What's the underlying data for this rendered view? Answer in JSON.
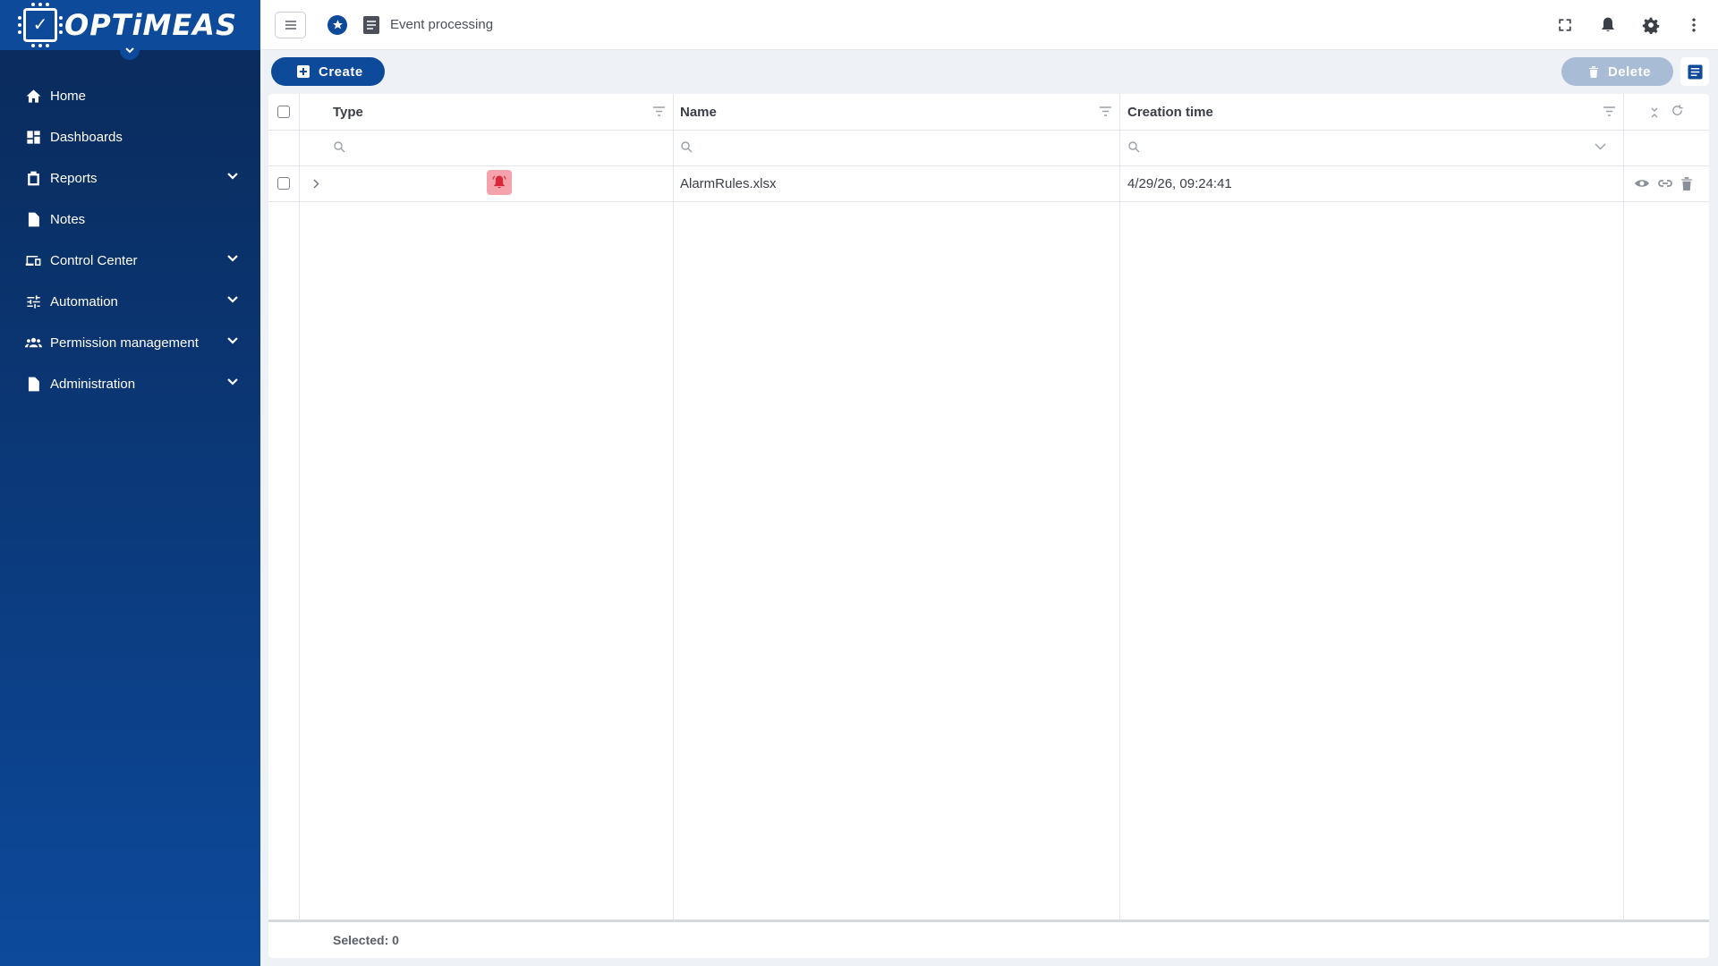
{
  "app": {
    "logo_text": "OPTiMEAS"
  },
  "sidebar": {
    "items": [
      {
        "label": "Home",
        "icon": "home-icon",
        "expandable": false
      },
      {
        "label": "Dashboards",
        "icon": "dashboard-icon",
        "expandable": false
      },
      {
        "label": "Reports",
        "icon": "clipboard-icon",
        "expandable": true
      },
      {
        "label": "Notes",
        "icon": "document-icon",
        "expandable": false
      },
      {
        "label": "Control Center",
        "icon": "devices-icon",
        "expandable": true
      },
      {
        "label": "Automation",
        "icon": "sliders-icon",
        "expandable": true
      },
      {
        "label": "Permission management",
        "icon": "group-icon",
        "expandable": true
      },
      {
        "label": "Administration",
        "icon": "admin-doc-icon",
        "expandable": true
      }
    ]
  },
  "header": {
    "page_title": "Event processing",
    "icons": [
      "fullscreen-icon",
      "bell-icon",
      "gear-icon",
      "more-vert-icon"
    ]
  },
  "toolbar": {
    "create_label": "Create",
    "delete_label": "Delete"
  },
  "table": {
    "columns": [
      "Type",
      "Name",
      "Creation time"
    ],
    "rows": [
      {
        "type_icon": "alarm-bell-icon",
        "name": "AlarmRules.xlsx",
        "creation_time": "4/29/26, 09:24:41"
      }
    ],
    "footer": {
      "selected_label": "Selected: 0"
    }
  },
  "colors": {
    "sidebar_top": "#0a2a5a",
    "sidebar_bottom": "#0d4a9c",
    "accent": "#0e4a9a",
    "delete_disabled": "#a9bcd6",
    "alarm_bg": "#f4a3ad",
    "alarm_fg": "#d62839"
  }
}
